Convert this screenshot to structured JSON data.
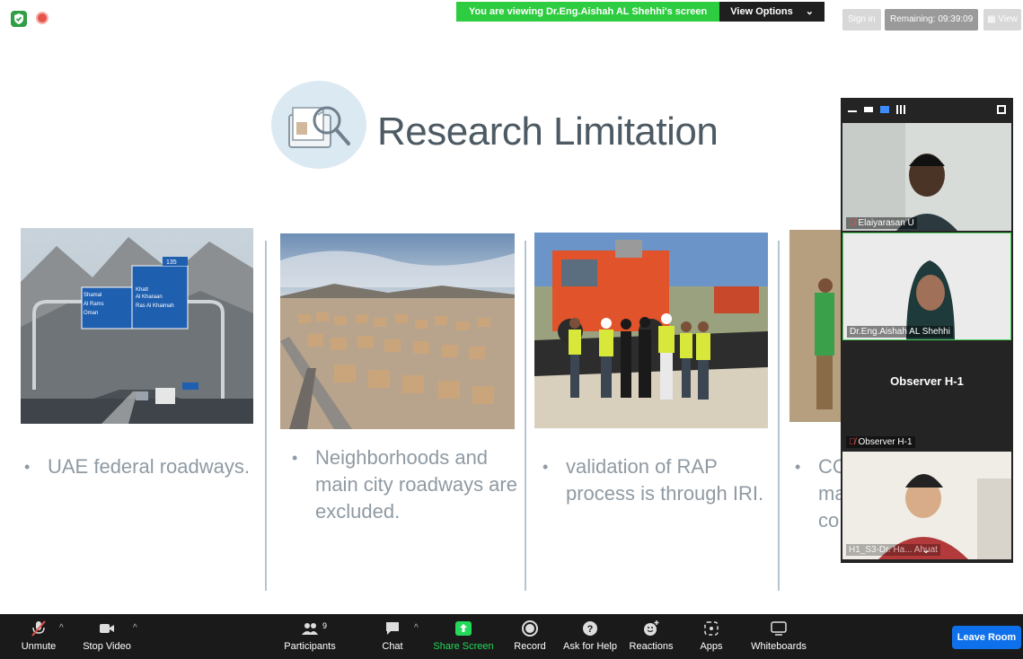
{
  "topbar": {
    "viewing_text": "You are viewing Dr.Eng.Aishah AL Shehhi's screen",
    "view_options_label": "View Options",
    "signin_label": "Sign in",
    "remaining_label": "Remaining: 09:39:09",
    "view_label": "View"
  },
  "slide": {
    "title": "Research Limitation",
    "bullets": [
      {
        "lines": [
          "UAE federal roadways."
        ]
      },
      {
        "lines": [
          "Neighborhoods and",
          "main city roadways are",
          "excluded."
        ]
      },
      {
        "lines": [
          "validation of RAP",
          "process is through IRI."
        ]
      },
      {
        "lines": [
          "CO",
          "ma",
          "co"
        ]
      }
    ],
    "road_sign": {
      "top_number": "135",
      "left_lines": [
        "Shamal",
        "Al Rams",
        "Oman"
      ],
      "right_lines": [
        "Khatt",
        "Al Kharaan",
        "Ras Al Khaimah"
      ]
    }
  },
  "participants_panel": {
    "tiles": [
      {
        "name": "Elaiyarasan U",
        "muted": true
      },
      {
        "name": "Dr.Eng.Aishah AL Shehhi",
        "muted": false
      },
      {
        "name": "Observer H-1",
        "center_label": "Observer H-1",
        "muted": true
      },
      {
        "name": "H1_S3-Dr. Ha... Ahuat",
        "muted": false
      }
    ]
  },
  "toolbar": {
    "unmute": "Unmute",
    "stop_video": "Stop Video",
    "participants": "Participants",
    "participants_count": "9",
    "chat": "Chat",
    "share_screen": "Share Screen",
    "record": "Record",
    "ask_for_help": "Ask for Help",
    "reactions": "Reactions",
    "apps": "Apps",
    "whiteboards": "Whiteboards",
    "leave_room": "Leave Room"
  },
  "colors": {
    "banner_green": "#2ecc40",
    "leave_blue": "#0e71eb",
    "toolbar_bg": "#1a1a1a",
    "share_green": "#23d959",
    "title_gray": "#4d5a63"
  }
}
